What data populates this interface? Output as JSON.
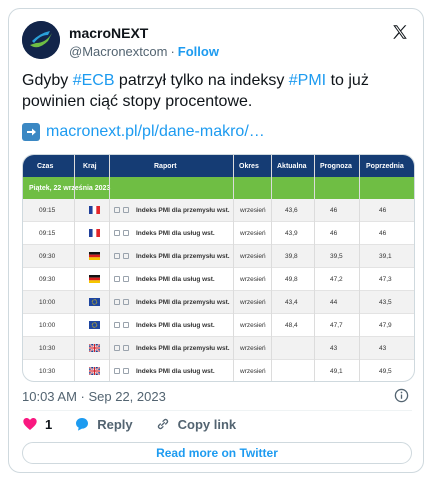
{
  "author": {
    "name": "macroNEXT",
    "handle": "@Macronextcom",
    "follow_label": "Follow"
  },
  "tweet": {
    "text_part1": "Gdyby ",
    "hashtag1": "#ECB",
    "text_part2": " patrzył tylko na indeksy ",
    "hashtag2": "#PMI",
    "text_part3": " to już powinien ciąć stopy procentowe.",
    "link": "macronext.pl/pl/dane-makro/…"
  },
  "table": {
    "headers": {
      "time": "Czas",
      "country": "Kraj",
      "report": "Raport",
      "period": "Okres",
      "actual": "Aktualna",
      "forecast": "Prognoza",
      "previous": "Poprzednia"
    },
    "date_label": "Piątek, 22 września 2023",
    "rows": [
      {
        "time": "09:15",
        "flag": "france",
        "report": "Indeks PMI dla przemysłu wst.",
        "period": "wrzesień",
        "actual": "43,6",
        "forecast": "46",
        "previous": "46"
      },
      {
        "time": "09:15",
        "flag": "france",
        "report": "Indeks PMI dla usług wst.",
        "period": "wrzesień",
        "actual": "43,9",
        "forecast": "46",
        "previous": "46"
      },
      {
        "time": "09:30",
        "flag": "germany",
        "report": "Indeks PMI dla przemysłu wst.",
        "period": "wrzesień",
        "actual": "39,8",
        "forecast": "39,5",
        "previous": "39,1"
      },
      {
        "time": "09:30",
        "flag": "germany",
        "report": "Indeks PMI dla usług wst.",
        "period": "wrzesień",
        "actual": "49,8",
        "forecast": "47,2",
        "previous": "47,3"
      },
      {
        "time": "10:00",
        "flag": "eu",
        "report": "Indeks PMI dla przemysłu wst.",
        "period": "wrzesień",
        "actual": "43,4",
        "forecast": "44",
        "previous": "43,5"
      },
      {
        "time": "10:00",
        "flag": "eu",
        "report": "Indeks PMI dla usług wst.",
        "period": "wrzesień",
        "actual": "48,4",
        "forecast": "47,7",
        "previous": "47,9"
      },
      {
        "time": "10:30",
        "flag": "uk",
        "report": "Indeks PMI dla przemysłu wst.",
        "period": "wrzesień",
        "actual": "",
        "forecast": "43",
        "previous": "43"
      },
      {
        "time": "10:30",
        "flag": "uk",
        "report": "Indeks PMI dla usług wst.",
        "period": "wrzesień",
        "actual": "",
        "forecast": "49,1",
        "previous": "49,5"
      }
    ]
  },
  "footer": {
    "timestamp": "10:03 AM · Sep 22, 2023",
    "like_count": "1",
    "reply_label": "Reply",
    "copy_link_label": "Copy link",
    "read_more_label": "Read more on Twitter"
  },
  "colors": {
    "accent": "#1d9bf0",
    "table_header": "#153c74",
    "date_bar": "#6fbe44",
    "heart": "#f91880"
  }
}
